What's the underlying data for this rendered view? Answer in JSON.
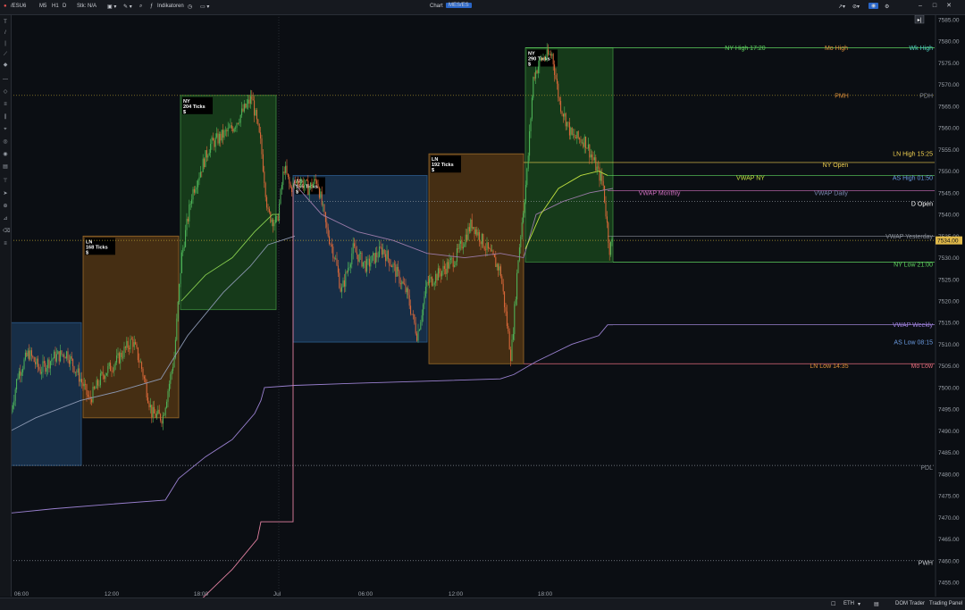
{
  "topbar": {
    "symbol": "/ESU6",
    "interval": "M5",
    "timeframe_h": "H1",
    "timeframe_d": "D",
    "stk_label": "Stk: N/A",
    "indicators_label": "Indikatoren",
    "center_label": "Chart",
    "center_badge": "MES/ES"
  },
  "price_axis": {
    "ticks": [
      "7585.00",
      "7580.00",
      "7575.00",
      "7570.00",
      "7565.00",
      "7560.00",
      "7555.00",
      "7550.00",
      "7545.00",
      "7540.00",
      "7535.00",
      "7530.00",
      "7525.00",
      "7520.00",
      "7515.00",
      "7510.00",
      "7505.00",
      "7500.00",
      "7495.00",
      "7490.00",
      "7485.00",
      "7480.00",
      "7475.00",
      "7470.00",
      "7465.00",
      "7460.00",
      "7455.00"
    ],
    "current_price": "7534.00",
    "current_color": "#e0b94a"
  },
  "time_axis": {
    "labels": [
      "06:00",
      "12:00",
      "18:00",
      "Jul",
      "06:00",
      "12:00",
      "18:00"
    ]
  },
  "sessions": [
    {
      "name": "AS-1",
      "label": "",
      "ticks": ""
    },
    {
      "name": "LN-1",
      "label": "LN",
      "ticks": "168 Ticks",
      "sub": "$"
    },
    {
      "name": "NY-1",
      "label": "NY",
      "ticks": "204 Ticks",
      "sub": "$"
    },
    {
      "name": "AS-2",
      "label": "AS",
      "ticks": "155 Ticks",
      "sub": "$"
    },
    {
      "name": "LN-2",
      "label": "LN",
      "ticks": "192 Ticks",
      "sub": "$"
    },
    {
      "name": "NY-2",
      "label": "NY",
      "ticks": "290 Ticks",
      "sub": "$"
    }
  ],
  "levels": {
    "ny_high": "NY High 17:20",
    "mo_high": "Mo High",
    "wk_high": "Wk High",
    "pmh": "PMH",
    "pdh": "PDH",
    "ln_high": "LN High 15:25",
    "ny_open": "NY Open",
    "vwap_ny": "VWAP NY",
    "as_high": "AS High 01:50",
    "vwap_monthly": "VWAP Monthly",
    "vwap_daily": "VWAP Daily",
    "d_open": "D Open",
    "vwap_yesterday": "VWAP Yesterday",
    "ny_low": "NY Low 21:00",
    "vwap_weekly": "VWAP Weekly",
    "as_low": "AS Low 08:15",
    "ln_low": "LN Low 14:35",
    "mo_low": "Mo Low",
    "pdl": "PDL",
    "pwh": "PWH"
  },
  "colors": {
    "as_box": "#1c3a5a",
    "ln_box": "#5a3a14",
    "ny_box": "#1b4a1e",
    "green_level": "#5fd35f",
    "orange_level": "#e0913a",
    "blue_level": "#6a9ae0",
    "pink_level": "#d070c0",
    "yellow_level": "#f0d050",
    "grey_level": "#8a8f98",
    "candle_up": "#4fb85a",
    "candle_down": "#e06a3a"
  },
  "bottombar": {
    "eth_label": "ETH",
    "dom_trader": "DOM Trader",
    "trading_panel": "Trading Panel"
  }
}
